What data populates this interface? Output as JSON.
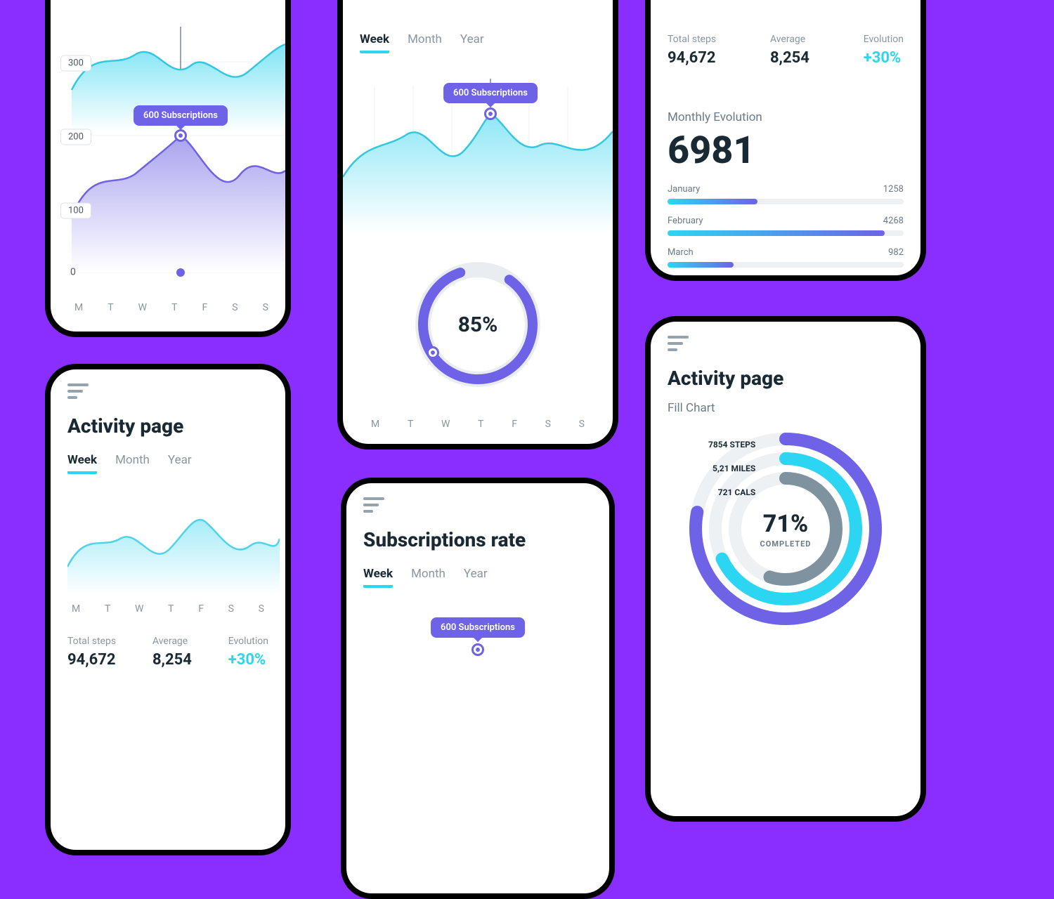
{
  "common": {
    "tabs": {
      "week": "Week",
      "month": "Month",
      "year": "Year"
    },
    "days": [
      "M",
      "T",
      "W",
      "T",
      "F",
      "S",
      "S"
    ],
    "tooltip": "600 Subscriptions"
  },
  "phone1": {
    "yticks": {
      "t300": "300",
      "t200": "200",
      "t100": "100",
      "t0": "0"
    }
  },
  "phone2": {
    "donut_pct": "85%"
  },
  "phone3": {
    "stats": {
      "total_label": "Total steps",
      "total_value": "94,672",
      "avg_label": "Average",
      "avg_value": "8,254",
      "evo_label": "Evolution",
      "evo_value": "+30%"
    },
    "monthly_label": "Monthly Evolution",
    "monthly_value": "6981",
    "bars": {
      "jan_label": "January",
      "jan_value": "1258",
      "feb_label": "February",
      "feb_value": "4268",
      "mar_label": "March",
      "mar_value": "982"
    }
  },
  "phone4": {
    "title": "Activity page",
    "stats": {
      "total_label": "Total steps",
      "total_value": "94,672",
      "avg_label": "Average",
      "avg_value": "8,254",
      "evo_label": "Evolution",
      "evo_value": "+30%"
    }
  },
  "phone5": {
    "title": "Subscriptions rate"
  },
  "phone6": {
    "title": "Activity page",
    "subtitle": "Fill Chart",
    "rings": {
      "steps": "7854 STEPS",
      "miles": "5,21 MILES",
      "cals": "721  CALS"
    },
    "center_pct": "71%",
    "center_sub": "COMPLETED"
  },
  "chart_data": [
    {
      "id": "phone1-top-area",
      "type": "area",
      "categories": [
        "M",
        "T",
        "W",
        "T",
        "F",
        "S",
        "S"
      ],
      "values": [
        260,
        310,
        290,
        340,
        260,
        300,
        330
      ],
      "ylim": [
        0,
        350
      ],
      "color": "cyan"
    },
    {
      "id": "phone1-bottom-area",
      "type": "area",
      "categories": [
        "M",
        "T",
        "W",
        "T",
        "F",
        "S",
        "S"
      ],
      "values": [
        140,
        180,
        170,
        200,
        130,
        180,
        160
      ],
      "ylim": [
        0,
        350
      ],
      "color": "purple",
      "tooltip": {
        "category": "T",
        "index": 3,
        "value": 200,
        "label": "600 Subscriptions"
      }
    },
    {
      "id": "phone2-area",
      "type": "area",
      "categories": [
        "M",
        "T",
        "W",
        "T",
        "F",
        "S",
        "S"
      ],
      "values": [
        60,
        90,
        70,
        100,
        80,
        70,
        95
      ],
      "ylim": [
        0,
        120
      ],
      "color": "cyan",
      "tooltip": {
        "category": "T",
        "index": 3,
        "value": 100,
        "label": "600 Subscriptions"
      }
    },
    {
      "id": "phone2-donut",
      "type": "pie",
      "subtype": "donut-progress",
      "value": 85,
      "max": 100,
      "label": "85%"
    },
    {
      "id": "phone3-bars",
      "type": "bar",
      "orientation": "horizontal",
      "categories": [
        "January",
        "February",
        "March"
      ],
      "values": [
        1258,
        4268,
        982
      ],
      "title": "Monthly Evolution",
      "total": 6981
    },
    {
      "id": "phone4-area",
      "type": "area",
      "categories": [
        "M",
        "T",
        "W",
        "T",
        "F",
        "S",
        "S"
      ],
      "values": [
        55,
        80,
        60,
        95,
        70,
        60,
        85
      ],
      "ylim": [
        0,
        120
      ],
      "color": "cyan"
    },
    {
      "id": "phone6-rings",
      "type": "pie",
      "subtype": "radial-progress-multi",
      "series": [
        {
          "name": "7854 STEPS",
          "value": 78,
          "color": "#6e63e6"
        },
        {
          "name": "5,21 MILES",
          "value": 68,
          "color": "#2cd6f2"
        },
        {
          "name": "721 CALS",
          "value": 55,
          "color": "#7f92a0"
        }
      ],
      "center": {
        "value": 71,
        "label": "COMPLETED"
      }
    }
  ]
}
